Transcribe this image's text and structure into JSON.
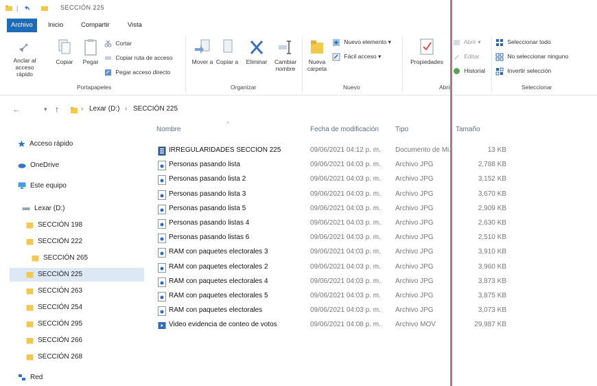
{
  "window": {
    "title": "SECCIÓN 225",
    "titlebar_icons": [
      "folder-icon",
      "undo-icon",
      "folder-icon"
    ]
  },
  "ribbon": {
    "tabs": [
      {
        "label": "Archivo",
        "active": true
      },
      {
        "label": "Inicio",
        "active": false
      },
      {
        "label": "Compartir",
        "active": false
      },
      {
        "label": "Vista",
        "active": false
      }
    ],
    "portapapeles": {
      "pin_label": "Anclar al acceso rápido",
      "copy_label": "Copiar",
      "paste_label": "Pegar",
      "cut_label": "Cortar",
      "copy_path_label": "Copiar ruta de acceso",
      "paste_shortcut_label": "Pegar acceso directo",
      "group_label": "Portapapeles"
    },
    "organizar": {
      "move_label": "Mover a",
      "copy_to_label": "Copiar a",
      "delete_label": "Eliminar",
      "rename_label": "Cambiar nombre",
      "group_label": "Organizar"
    },
    "nuevo": {
      "new_folder_label": "Nueva carpeta",
      "new_item_label": "Nuevo elemento",
      "easy_access_label": "Fácil acceso",
      "group_label": "Nuevo"
    },
    "abrir": {
      "properties_label": "Propiedades",
      "open_label": "Abrir",
      "edit_label": "Editar",
      "history_label": "Historial",
      "group_label": "Abrir"
    },
    "seleccionar": {
      "select_all_label": "Seleccionar todo",
      "select_none_label": "No seleccionar ninguno",
      "invert_label": "Invertir selección",
      "group_label": "Seleccionar"
    }
  },
  "address": {
    "crumbs": [
      "Lexar (D:)",
      "SECCIÓN 225"
    ]
  },
  "nav": {
    "quick_access": "Acceso rápido",
    "onedrive": "OneDrive",
    "this_pc": "Este equipo",
    "drive": "Lexar (D:)",
    "folders": [
      "SECCIÓN 198",
      "SECCIÓN 222",
      "SECCIÓN 265",
      "SECCIÓN 225",
      "SECCIÓN 263",
      "SECCIÓN 254",
      "SECCIÓN 295",
      "SECCIÓN 266",
      "SECCIÓN 268"
    ],
    "network": "Red"
  },
  "columns": {
    "name": "Nombre",
    "date": "Fecha de modificación",
    "type": "Tipo",
    "size": "Tamaño"
  },
  "files": [
    {
      "name": "IRREGULARIDADES SECCIÓN 225",
      "date": "09/06/2021 04:12 p. m.",
      "type": "Documento de Mi...",
      "size": "13 KB",
      "icon": "word-doc-icon"
    },
    {
      "name": "Personas pasando lista",
      "date": "09/06/2021 04:03 p. m.",
      "type": "Archivo JPG",
      "size": "2,788 KB",
      "icon": "image-file-icon"
    },
    {
      "name": "Personas pasando lista 2",
      "date": "09/06/2021 04:03 p. m.",
      "type": "Archivo JPG",
      "size": "3,152 KB",
      "icon": "image-file-icon"
    },
    {
      "name": "Personas pasando lista 3",
      "date": "09/06/2021 04:03 p. m.",
      "type": "Archivo JPG",
      "size": "3,670 KB",
      "icon": "image-file-icon"
    },
    {
      "name": "Personas pasando lista 5",
      "date": "09/06/2021 04:03 p. m.",
      "type": "Archivo JPG",
      "size": "2,909 KB",
      "icon": "image-file-icon"
    },
    {
      "name": "Personas pasando listas 4",
      "date": "09/06/2021 04:03 p. m.",
      "type": "Archivo JPG",
      "size": "2,630 KB",
      "icon": "image-file-icon"
    },
    {
      "name": "Personas pasando listas 6",
      "date": "09/06/2021 04:03 p. m.",
      "type": "Archivo JPG",
      "size": "2,510 KB",
      "icon": "image-file-icon"
    },
    {
      "name": "RAM con paquetes electorales 3",
      "date": "09/06/2021 04:03 p. m.",
      "type": "Archivo JPG",
      "size": "3,910 KB",
      "icon": "image-file-icon"
    },
    {
      "name": "RAM con paquetes electorales 2",
      "date": "09/06/2021 04:03 p. m.",
      "type": "Archivo JPG",
      "size": "3,960 KB",
      "icon": "image-file-icon"
    },
    {
      "name": "RAM con paquetes electorales 4",
      "date": "09/06/2021 04:03 p. m.",
      "type": "Archivo JPG",
      "size": "3,873 KB",
      "icon": "image-file-icon"
    },
    {
      "name": "RAM con paquetes electorales 5",
      "date": "09/06/2021 04:03 p. m.",
      "type": "Archivo JPG",
      "size": "3,875 KB",
      "icon": "image-file-icon"
    },
    {
      "name": "RAM con paquetes electorales",
      "date": "09/06/2021 04:03 p. m.",
      "type": "Archivo JPG",
      "size": "3,073 KB",
      "icon": "image-file-icon"
    },
    {
      "name": "Video evidencia de conteo de votos",
      "date": "09/06/2021 04:08 p. m.",
      "type": "Archivo MOV",
      "size": "29,987 KB",
      "icon": "video-file-icon"
    }
  ],
  "colors": {
    "accent": "#1e6bb8",
    "folder": "#f2c94c",
    "selection": "#dce8f6",
    "overlay_line": "#9b7f86"
  }
}
